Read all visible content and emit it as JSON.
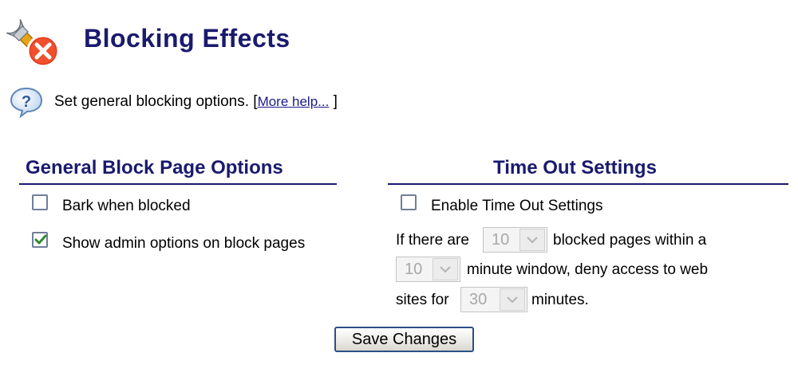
{
  "header": {
    "title": "Blocking Effects",
    "logo_icon": "wrench-block-icon"
  },
  "help": {
    "icon": "help-question-icon",
    "text": "Set general blocking options.",
    "bracket_open": "[",
    "link_label": "More help...",
    "bracket_close": "]"
  },
  "general": {
    "title": "General Block Page Options",
    "bark": {
      "label": "Bark when blocked",
      "checked": false
    },
    "admin": {
      "label": "Show admin options on block pages",
      "checked": true
    }
  },
  "timeout": {
    "title": "Time Out Settings",
    "enable": {
      "label": "Enable Time Out Settings",
      "checked": false
    },
    "sentence": {
      "part1": "If there are",
      "part2": "blocked pages within a",
      "part3": "minute window, deny access to web",
      "part4": "sites for",
      "part5": "minutes."
    },
    "pages_value": "10",
    "window_value": "10",
    "minutes_value": "30"
  },
  "actions": {
    "save_label": "Save Changes"
  },
  "colors": {
    "heading": "#1a1a6e",
    "link": "#1a1a8c",
    "button_border": "#2b4f86",
    "check": "#2f8a2f"
  }
}
